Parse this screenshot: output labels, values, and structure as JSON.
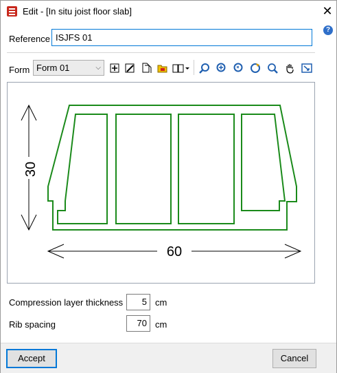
{
  "window": {
    "title": "Edit - [In situ joist floor slab]",
    "close_glyph": "✕",
    "help_glyph": "?"
  },
  "reference": {
    "label": "Reference",
    "value": "ISJFS 01"
  },
  "form": {
    "label": "Form",
    "selected": "Form 01",
    "chevron": "⌵"
  },
  "toolbar": {
    "icons": [
      "add-icon",
      "edit-icon",
      "copy-icon",
      "open-folder-icon",
      "library-icon",
      "zoom-previous-icon",
      "zoom-window-icon",
      "zoom-x2-icon",
      "refresh-icon",
      "zoom-icon",
      "pan-hand-icon",
      "zoom-extents-icon"
    ]
  },
  "drawing": {
    "height_dimension": "30",
    "width_dimension": "60",
    "line_color": "#1a8a1a"
  },
  "fields": {
    "compression": {
      "label": "Compression layer thickness",
      "value": "5",
      "unit": "cm"
    },
    "rib_spacing": {
      "label": "Rib spacing",
      "value": "70",
      "unit": "cm"
    }
  },
  "buttons": {
    "accept": "Accept",
    "cancel": "Cancel"
  }
}
